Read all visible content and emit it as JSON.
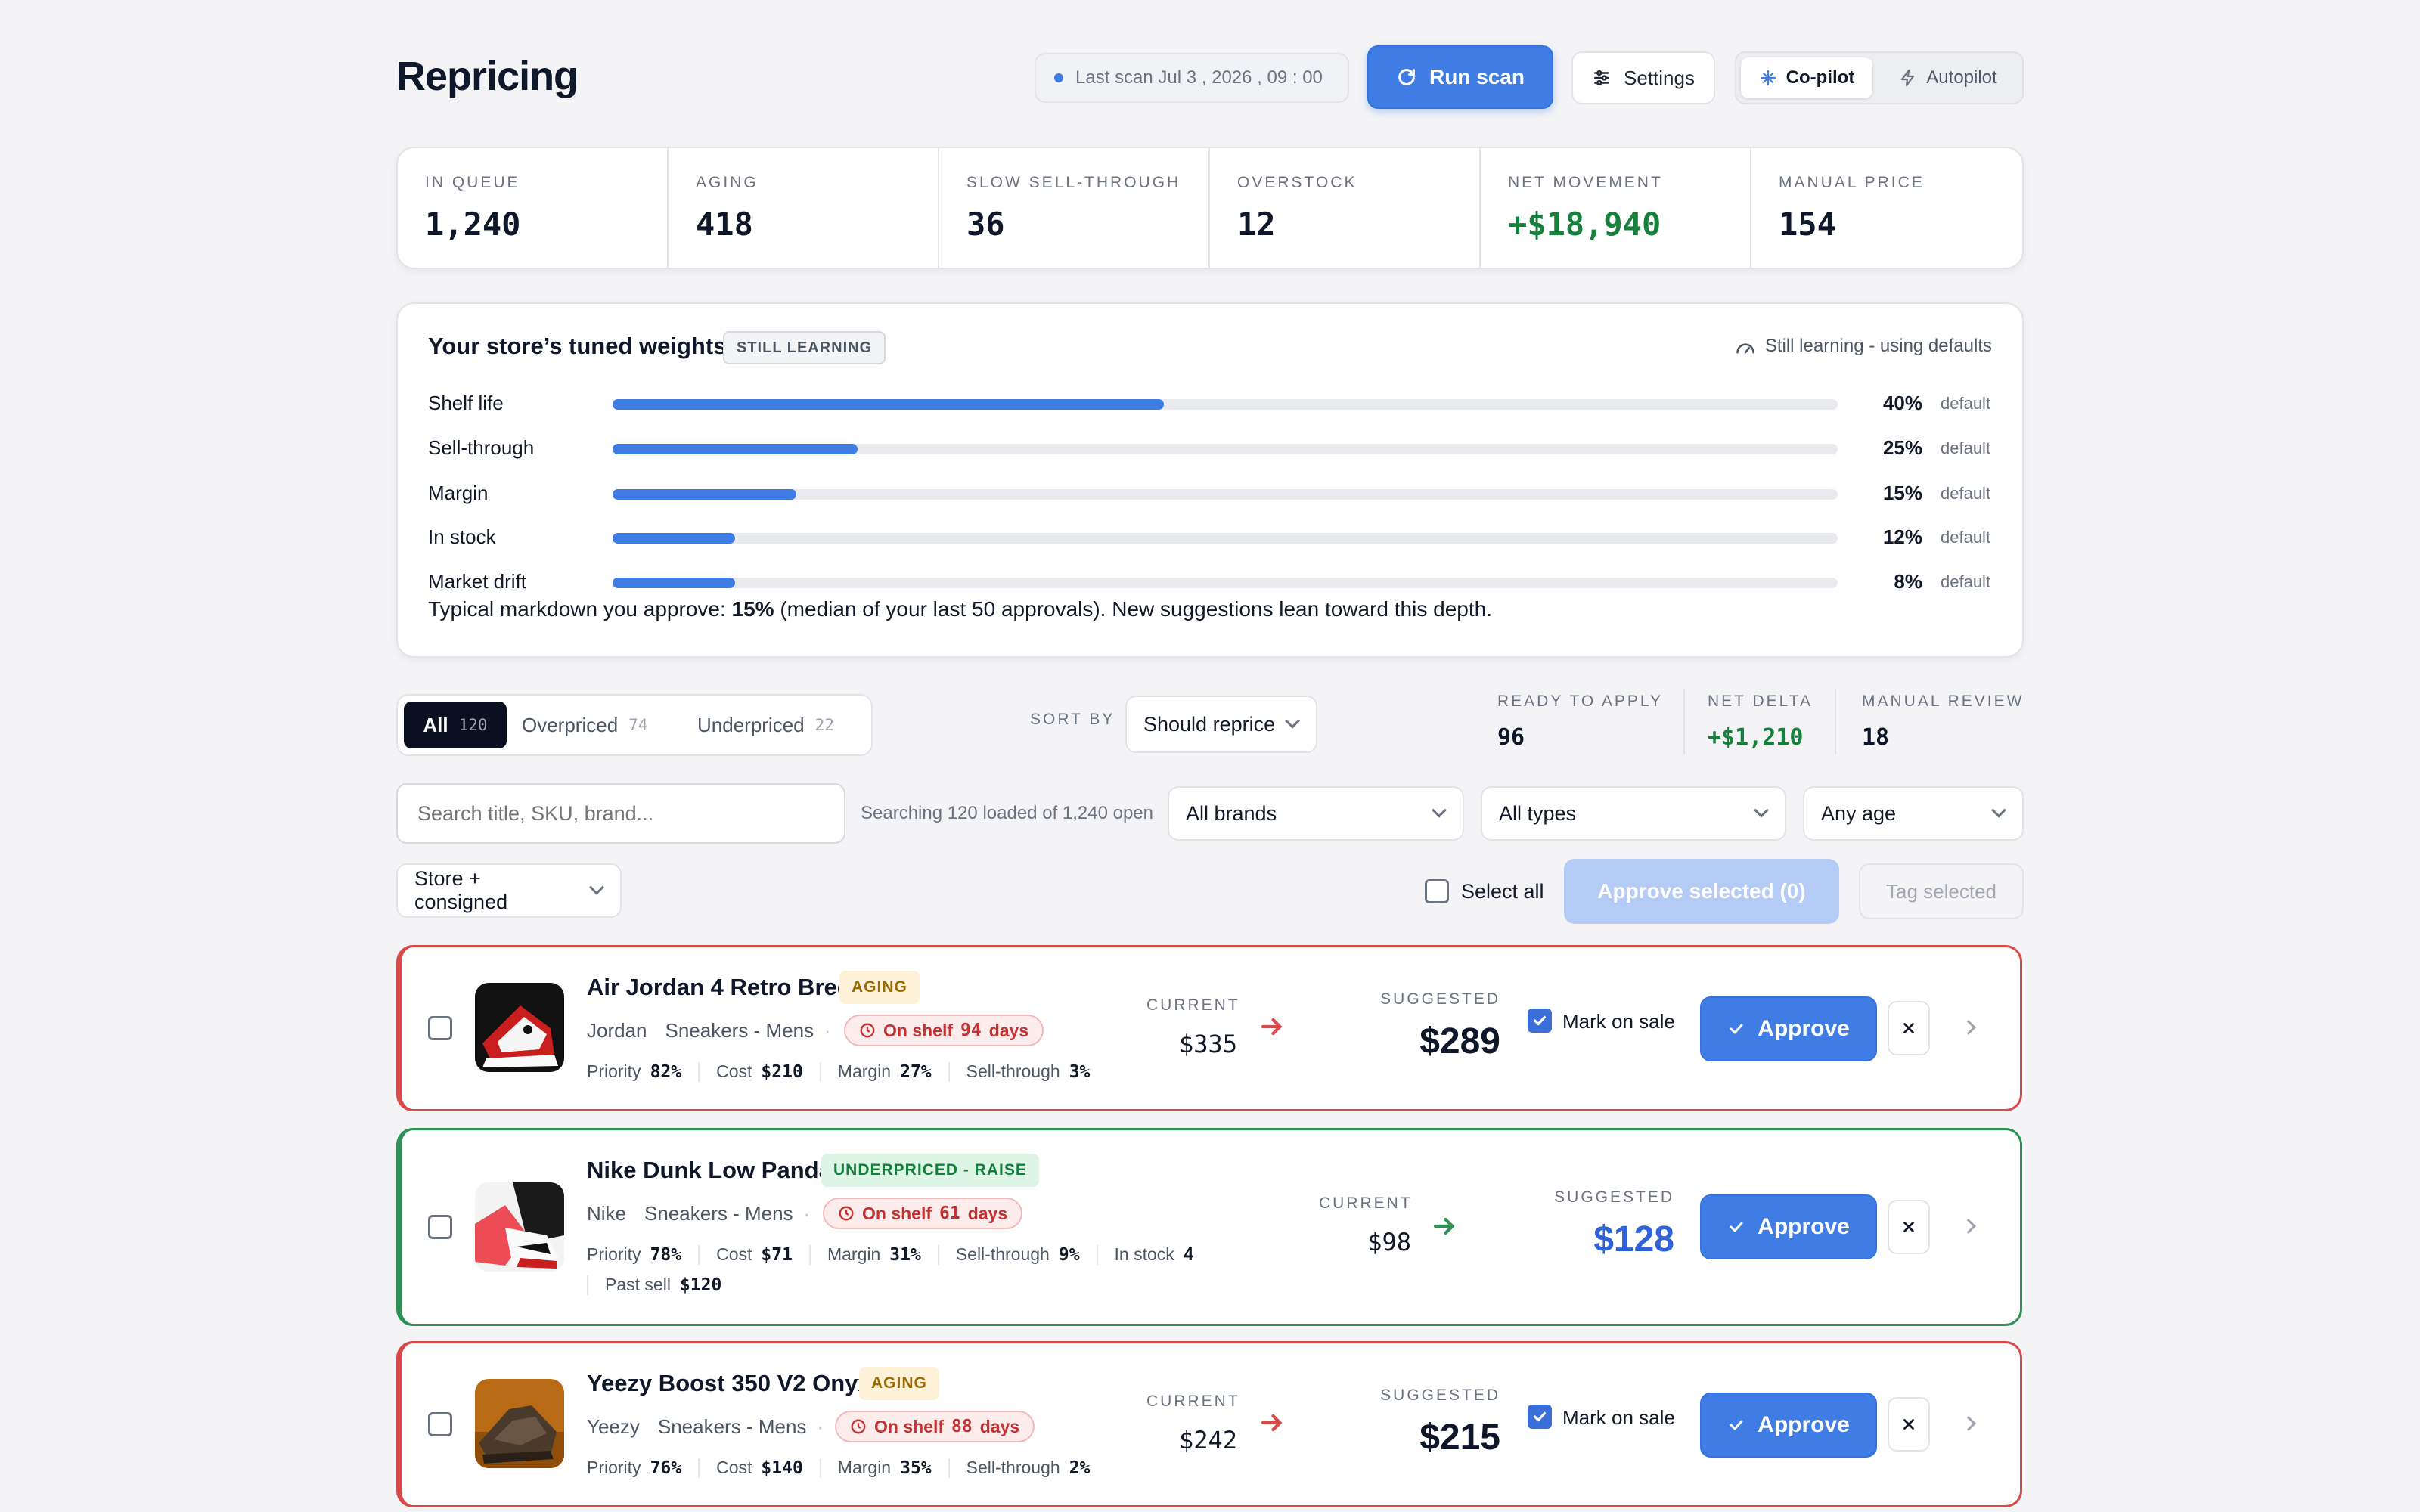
{
  "header": {
    "title": "Repricing",
    "last_scan": "Last scan Jul 3 , 2026 , 09 : 00",
    "run_scan_label": "Run scan",
    "settings_label": "Settings",
    "mode_copilot": "Co-pilot",
    "mode_autopilot": "Autopilot"
  },
  "stats": [
    {
      "label": "IN QUEUE",
      "value": "1,240"
    },
    {
      "label": "AGING",
      "value": "418"
    },
    {
      "label": "SLOW SELL-THROUGH",
      "value": "36"
    },
    {
      "label": "OVERSTOCK",
      "value": "12"
    },
    {
      "label": "NET MOVEMENT",
      "value": "+$18,940"
    },
    {
      "label": "MANUAL PRICE",
      "value": "154"
    }
  ],
  "weights": {
    "title": "Your store’s tuned weights",
    "badge": "STILL LEARNING",
    "status": "Still learning - using defaults",
    "items": [
      {
        "label": "Shelf life",
        "pct_text": "40%",
        "fraction": 0.45,
        "tag": "default"
      },
      {
        "label": "Sell-through",
        "pct_text": "25%",
        "fraction": 0.2,
        "tag": "default"
      },
      {
        "label": "Margin",
        "pct_text": "15%",
        "fraction": 0.15,
        "tag": "default"
      },
      {
        "label": "In stock",
        "pct_text": "12%",
        "fraction": 0.1,
        "tag": "default"
      },
      {
        "label": "Market drift",
        "pct_text": "8%",
        "fraction": 0.1,
        "tag": "default"
      }
    ],
    "note_prefix": "Typical markdown you approve: ",
    "note_value": "15%",
    "note_suffix": " (median of your last 50 approvals). New suggestions lean toward this depth."
  },
  "filters": {
    "tabs": [
      {
        "label": "All",
        "count": "120"
      },
      {
        "label": "Overpriced",
        "count": "74"
      },
      {
        "label": "Underpriced",
        "count": "22"
      }
    ],
    "sort_by_label": "SORT BY",
    "sort_value": "Should reprice",
    "summary": [
      {
        "label": "READY TO APPLY",
        "value": "96"
      },
      {
        "label": "NET DELTA",
        "value": "+$1,210"
      },
      {
        "label": "MANUAL REVIEW",
        "value": "18"
      }
    ],
    "search_placeholder": "Search title, SKU, brand...",
    "search_status": "Searching 120 loaded of 1,240 open",
    "brands": "All brands",
    "types": "All types",
    "age": "Any age",
    "source": "Store + consigned",
    "select_all": "Select all",
    "approve_selected": "Approve selected (0)",
    "tag_selected": "Tag selected"
  },
  "items": [
    {
      "title": "Air Jordan 4 Retro Bred",
      "badge": "AGING",
      "brand": "Jordan",
      "category": "Sneakers - Mens",
      "shelf_prefix": "On shelf",
      "shelf_days": "94",
      "shelf_suffix": "days",
      "priority": "82%",
      "cost": "$210",
      "margin": "27%",
      "sell_through": "3%",
      "current_label": "CURRENT",
      "current": "$335",
      "suggested_label": "SUGGESTED",
      "suggested": "$289",
      "mark_on_sale": "Mark on sale",
      "approve": "Approve"
    },
    {
      "title": "Nike Dunk Low Panda",
      "badge": "UNDERPRICED - RAISE",
      "brand": "Nike",
      "category": "Sneakers - Mens",
      "shelf_prefix": "On shelf",
      "shelf_days": "61",
      "shelf_suffix": "days",
      "priority": "78%",
      "cost": "$71",
      "margin": "31%",
      "sell_through": "9%",
      "in_stock": "4",
      "past_sell": "$120",
      "current_label": "CURRENT",
      "current": "$98",
      "suggested_label": "SUGGESTED",
      "suggested": "$128",
      "approve": "Approve"
    },
    {
      "title": "Yeezy Boost 350 V2 Onyx",
      "badge": "AGING",
      "brand": "Yeezy",
      "category": "Sneakers - Mens",
      "shelf_prefix": "On shelf",
      "shelf_days": "88",
      "shelf_suffix": "days",
      "priority": "76%",
      "cost": "$140",
      "margin": "35%",
      "sell_through": "2%",
      "current_label": "CURRENT",
      "current": "$242",
      "suggested_label": "SUGGESTED",
      "suggested": "$215",
      "mark_on_sale": "Mark on sale",
      "approve": "Approve"
    }
  ],
  "labels": {
    "priority": "Priority",
    "cost": "Cost",
    "margin": "Margin",
    "sell_through": "Sell-through",
    "in_stock": "In stock",
    "past_sell": "Past sell"
  },
  "colors": {
    "accent": "#3f7de5",
    "positive": "#16803c",
    "negative": "#d84a4a",
    "suggest_raise": "#2f63d8"
  }
}
